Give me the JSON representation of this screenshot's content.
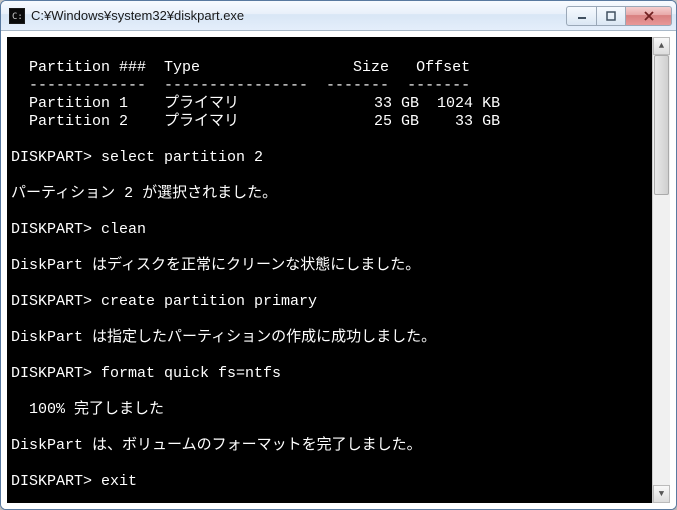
{
  "window": {
    "title": "C:¥Windows¥system32¥diskpart.exe"
  },
  "table": {
    "cols": [
      "Partition ###",
      "Type",
      "Size",
      "Offset"
    ],
    "rows": [
      {
        "num": "Partition 1",
        "type": "プライマリ",
        "size": "33 GB",
        "offset": "1024 KB"
      },
      {
        "num": "Partition 2",
        "type": "プライマリ",
        "size": "25 GB",
        "offset": "33 GB"
      }
    ]
  },
  "prompt": "DISKPART>",
  "lines": {
    "cmd_select": "select partition 2",
    "msg_selected": "パーティション 2 が選択されました。",
    "cmd_clean": "clean",
    "msg_cleaned": "DiskPart はディスクを正常にクリーンな状態にしました。",
    "cmd_create": "create partition primary",
    "msg_created": "DiskPart は指定したパーティションの作成に成功しました。",
    "cmd_format": "format quick fs=ntfs",
    "msg_progress": "  100% 完了しました",
    "msg_formatted": "DiskPart は、ボリュームのフォーマットを完了しました。",
    "cmd_exit": "exit"
  }
}
